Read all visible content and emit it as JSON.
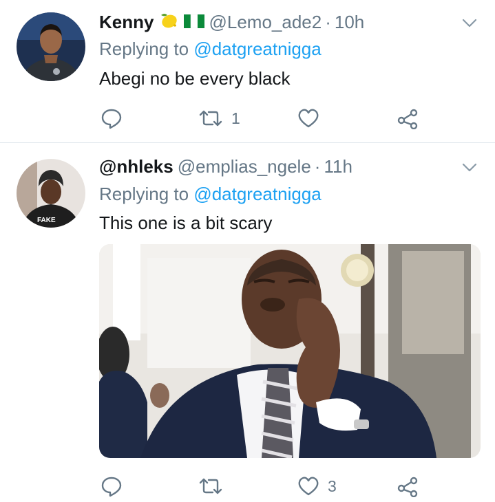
{
  "tweets": [
    {
      "display_name": "Kenny",
      "emojis": [
        "lemon-emoji",
        "nigeria-flag-emoji"
      ],
      "handle": "@Lemo_ade2",
      "separator": "·",
      "time": "10h",
      "replying_prefix": "Replying to",
      "replying_to": "@datgreatnigga",
      "text": "Abegi no be every black",
      "actions": {
        "reply_icon": "reply-icon",
        "retweet_icon": "retweet-icon",
        "retweet_count": "1",
        "like_icon": "heart-icon",
        "like_count": "",
        "share_icon": "share-icon"
      }
    },
    {
      "display_name": "@nhleks",
      "handle": "@emplias_ngele",
      "separator": "·",
      "time": "11h",
      "replying_prefix": "Replying to",
      "replying_to": "@datgreatnigga",
      "text": "This one is a bit scary",
      "media": "photo of a man in a suit with a pained expression raising his hand",
      "actions": {
        "reply_icon": "reply-icon",
        "retweet_icon": "retweet-icon",
        "retweet_count": "",
        "like_icon": "heart-icon",
        "like_count": "3",
        "share_icon": "share-icon"
      }
    }
  ],
  "colors": {
    "text": "#14171a",
    "secondary": "#657786",
    "link": "#1da1f2",
    "divider": "#e1e8ed"
  }
}
